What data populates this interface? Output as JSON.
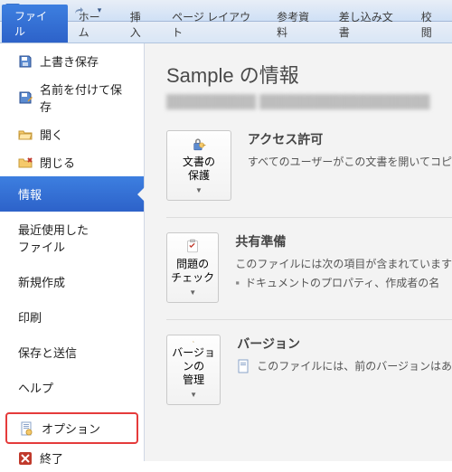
{
  "qat": {
    "app_letter": "W"
  },
  "ribbon": {
    "file": "ファイル",
    "tabs": [
      "ホーム",
      "挿入",
      "ページ レイアウト",
      "参考資料",
      "差し込み文書",
      "校閲"
    ]
  },
  "nav": {
    "save_as_overwrite": "上書き保存",
    "save_as": "名前を付けて保存",
    "open": "開く",
    "close": "閉じる",
    "info": "情報",
    "recent": "最近使用した\nファイル",
    "new": "新規作成",
    "print": "印刷",
    "save_send": "保存と送信",
    "help": "ヘルプ",
    "options": "オプション",
    "exit": "終了"
  },
  "content": {
    "title": "Sample の情報",
    "subtitle": "██████████ ███████████████████",
    "permissions": {
      "button": "文書の\n保護",
      "heading": "アクセス許可",
      "desc": "すべてのユーザーがこの文書を開いてコピ"
    },
    "prepare": {
      "button": "問題の\nチェック",
      "heading": "共有準備",
      "desc": "このファイルには次の項目が含まれています",
      "bullet": "ドキュメントのプロパティ、作成者の名"
    },
    "versions": {
      "button": "バージョンの\n管理",
      "heading": "バージョン",
      "desc": "このファイルには、前のバージョンはあ"
    }
  }
}
